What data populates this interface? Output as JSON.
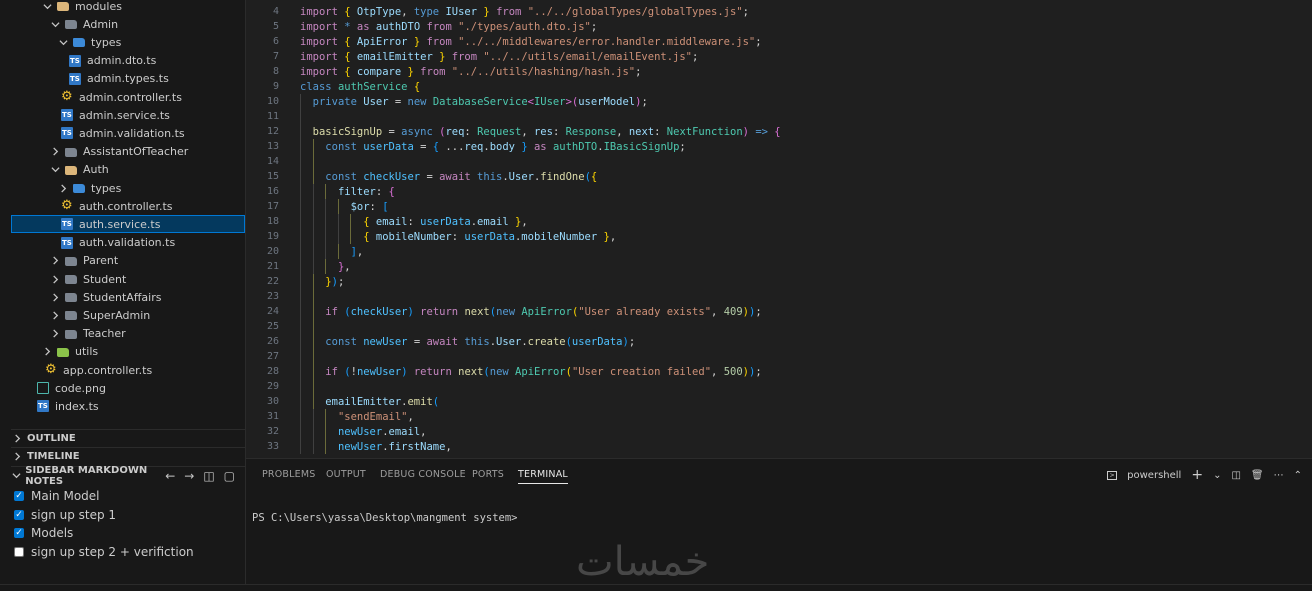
{
  "explorer": {
    "items": [
      {
        "label": "modules",
        "depth": 1,
        "kind": "folder-open",
        "icon": "folder-special"
      },
      {
        "label": "Admin",
        "depth": 2,
        "kind": "folder-open",
        "icon": "folder"
      },
      {
        "label": "types",
        "depth": 3,
        "kind": "folder-open",
        "icon": "folder-blue"
      },
      {
        "label": "admin.dto.ts",
        "depth": 4,
        "kind": "file",
        "icon": "ts"
      },
      {
        "label": "admin.types.ts",
        "depth": 4,
        "kind": "file",
        "icon": "ts"
      },
      {
        "label": "admin.controller.ts",
        "depth": 3,
        "kind": "file",
        "icon": "gear"
      },
      {
        "label": "admin.service.ts",
        "depth": 3,
        "kind": "file",
        "icon": "ts"
      },
      {
        "label": "admin.validation.ts",
        "depth": 3,
        "kind": "file",
        "icon": "ts"
      },
      {
        "label": "AssistantOfTeacher",
        "depth": 2,
        "kind": "folder",
        "icon": "folder"
      },
      {
        "label": "Auth",
        "depth": 2,
        "kind": "folder-open",
        "icon": "folder-special"
      },
      {
        "label": "types",
        "depth": 3,
        "kind": "folder",
        "icon": "folder-blue"
      },
      {
        "label": "auth.controller.ts",
        "depth": 3,
        "kind": "file",
        "icon": "gear"
      },
      {
        "label": "auth.service.ts",
        "depth": 3,
        "kind": "file",
        "icon": "ts",
        "selected": true
      },
      {
        "label": "auth.validation.ts",
        "depth": 3,
        "kind": "file",
        "icon": "ts"
      },
      {
        "label": "Parent",
        "depth": 2,
        "kind": "folder",
        "icon": "folder"
      },
      {
        "label": "Student",
        "depth": 2,
        "kind": "folder",
        "icon": "folder"
      },
      {
        "label": "StudentAffairs",
        "depth": 2,
        "kind": "folder",
        "icon": "folder"
      },
      {
        "label": "SuperAdmin",
        "depth": 2,
        "kind": "folder",
        "icon": "folder"
      },
      {
        "label": "Teacher",
        "depth": 2,
        "kind": "folder",
        "icon": "folder"
      },
      {
        "label": "utils",
        "depth": 1,
        "kind": "folder",
        "icon": "folder-green"
      },
      {
        "label": "app.controller.ts",
        "depth": 1,
        "kind": "file",
        "icon": "gear"
      },
      {
        "label": "code.png",
        "depth": 0,
        "kind": "file",
        "icon": "png"
      },
      {
        "label": "index.ts",
        "depth": 0,
        "kind": "file",
        "icon": "ts"
      }
    ]
  },
  "sections": {
    "outline": "OUTLINE",
    "timeline": "TIMELINE",
    "notes_title": "SIDEBAR MARKDOWN NOTES"
  },
  "notes": [
    {
      "label": "Main Model",
      "checked": true
    },
    {
      "label": "sign up step 1",
      "checked": true
    },
    {
      "label": "Models",
      "checked": true
    },
    {
      "label": "sign up step 2 + verifiction",
      "checked": false
    }
  ],
  "editor": {
    "lines": [
      {
        "n": "4",
        "indent": 0,
        "html": "<span class='kc'>import</span> <span class='y'>{</span> <span class='v'>OtpType</span>, <span class='k'>type</span> <span class='v'>IUser</span> <span class='y'>}</span> <span class='kc'>from</span> <span class='s'>\"../../globalTypes/globalTypes.js\"</span>;"
      },
      {
        "n": "5",
        "indent": 0,
        "html": "<span class='kc'>import</span> <span class='k'>*</span> <span class='kc'>as</span> <span class='v'>authDTO</span> <span class='kc'>from</span> <span class='s'>\"./types/auth.dto.js\"</span>;"
      },
      {
        "n": "6",
        "indent": 0,
        "html": "<span class='kc'>import</span> <span class='y'>{</span> <span class='v'>ApiError</span> <span class='y'>}</span> <span class='kc'>from</span> <span class='s'>\"../../middlewares/error.handler.middleware.js\"</span>;"
      },
      {
        "n": "7",
        "indent": 0,
        "html": "<span class='kc'>import</span> <span class='y'>{</span> <span class='v'>emailEmitter</span> <span class='y'>}</span> <span class='kc'>from</span> <span class='s'>\"../../utils/email/emailEvent.js\"</span>;"
      },
      {
        "n": "8",
        "indent": 0,
        "html": "<span class='kc'>import</span> <span class='y'>{</span> <span class='v'>compare</span> <span class='y'>}</span> <span class='kc'>from</span> <span class='s'>\"../../utils/hashing/hash.js\"</span>;"
      },
      {
        "n": "9",
        "indent": 0,
        "html": "<span class='k'>class</span> <span class='t'>authService</span> <span class='y'>{</span>"
      },
      {
        "n": "10",
        "indent": 1,
        "html": "  <span class='k'>private</span> <span class='v'>User</span> = <span class='k'>new</span> <span class='t'>DatabaseService</span><span class='p'>&lt;</span><span class='t'>IUser</span><span class='p'>&gt;</span><span class='p'>(</span><span class='v'>userModel</span><span class='p'>)</span>;"
      },
      {
        "n": "11",
        "indent": 1,
        "html": ""
      },
      {
        "n": "12",
        "indent": 1,
        "html": "  <span class='f'>basicSignUp</span> = <span class='k'>async</span> <span class='p'>(</span><span class='v'>req</span>: <span class='t'>Request</span>, <span class='v'>res</span>: <span class='t'>Response</span>, <span class='v'>next</span>: <span class='t'>NextFunction</span><span class='p'>)</span> <span class='k'>=&gt;</span> <span class='p'>{</span>"
      },
      {
        "n": "13",
        "indent": 2,
        "html": "    <span class='k'>const</span> <span class='c'>userData</span> = <span class='b'>{</span> ...<span class='v'>req</span>.<span class='v'>body</span> <span class='b'>}</span> <span class='kc'>as</span> <span class='t'>authDTO</span>.<span class='t'>IBasicSignUp</span>;"
      },
      {
        "n": "14",
        "indent": 2,
        "html": ""
      },
      {
        "n": "15",
        "indent": 2,
        "html": "    <span class='k'>const</span> <span class='c'>checkUser</span> = <span class='kc'>await</span> <span class='k'>this</span>.<span class='v'>User</span>.<span class='f'>findOne</span><span class='b'>(</span><span class='y'>{</span>"
      },
      {
        "n": "16",
        "indent": 3,
        "html": "      <span class='v'>filter</span>: <span class='p'>{</span>"
      },
      {
        "n": "17",
        "indent": 4,
        "html": "        <span class='v'>$or</span>: <span class='b'>[</span>"
      },
      {
        "n": "18",
        "indent": 5,
        "html": "          <span class='y'>{</span> <span class='v'>email</span>: <span class='c'>userData</span>.<span class='v'>email</span> <span class='y'>}</span>,"
      },
      {
        "n": "19",
        "indent": 5,
        "html": "          <span class='y'>{</span> <span class='v'>mobileNumber</span>: <span class='c'>userData</span>.<span class='v'>mobileNumber</span> <span class='y'>}</span>,"
      },
      {
        "n": "20",
        "indent": 4,
        "html": "        <span class='b'>]</span>,"
      },
      {
        "n": "21",
        "indent": 3,
        "html": "      <span class='p'>}</span>,"
      },
      {
        "n": "22",
        "indent": 2,
        "html": "    <span class='y'>}</span><span class='b'>)</span>;"
      },
      {
        "n": "23",
        "indent": 2,
        "html": ""
      },
      {
        "n": "24",
        "indent": 2,
        "html": "    <span class='kc'>if</span> <span class='b'>(</span><span class='c'>checkUser</span><span class='b'>)</span> <span class='kc'>return</span> <span class='f'>next</span><span class='b'>(</span><span class='k'>new</span> <span class='t'>ApiError</span><span class='y'>(</span><span class='s'>\"User already exists\"</span>, <span class='n'>409</span><span class='y'>)</span><span class='b'>)</span>;"
      },
      {
        "n": "25",
        "indent": 2,
        "html": ""
      },
      {
        "n": "26",
        "indent": 2,
        "html": "    <span class='k'>const</span> <span class='c'>newUser</span> = <span class='kc'>await</span> <span class='k'>this</span>.<span class='v'>User</span>.<span class='f'>create</span><span class='b'>(</span><span class='c'>userData</span><span class='b'>)</span>;"
      },
      {
        "n": "27",
        "indent": 2,
        "html": ""
      },
      {
        "n": "28",
        "indent": 2,
        "html": "    <span class='kc'>if</span> <span class='b'>(</span>!<span class='c'>newUser</span><span class='b'>)</span> <span class='kc'>return</span> <span class='f'>next</span><span class='b'>(</span><span class='k'>new</span> <span class='t'>ApiError</span><span class='y'>(</span><span class='s'>\"User creation failed\"</span>, <span class='n'>500</span><span class='y'>)</span><span class='b'>)</span>;"
      },
      {
        "n": "29",
        "indent": 2,
        "html": ""
      },
      {
        "n": "30",
        "indent": 2,
        "html": "    <span class='v'>emailEmitter</span>.<span class='f'>emit</span><span class='b'>(</span>"
      },
      {
        "n": "31",
        "indent": 3,
        "html": "      <span class='s'>\"sendEmail\"</span>,"
      },
      {
        "n": "32",
        "indent": 3,
        "html": "      <span class='c'>newUser</span>.<span class='v'>email</span>,"
      },
      {
        "n": "33",
        "indent": 3,
        "html": "      <span class='c'>newUser</span>.<span class='v'>firstName</span>,"
      }
    ]
  },
  "panel": {
    "tabs": [
      "PROBLEMS",
      "OUTPUT",
      "DEBUG CONSOLE",
      "PORTS",
      "TERMINAL"
    ],
    "active_tab": "TERMINAL",
    "terminal_name": "powershell",
    "prompt": "PS C:\\Users\\yassa\\Desktop\\mangment system>"
  },
  "watermark": "خمسات",
  "colors": {
    "accent": "#0078d4",
    "selection": "#04395e",
    "editor_bg": "#1f1f1f",
    "sidebar_bg": "#181818"
  }
}
